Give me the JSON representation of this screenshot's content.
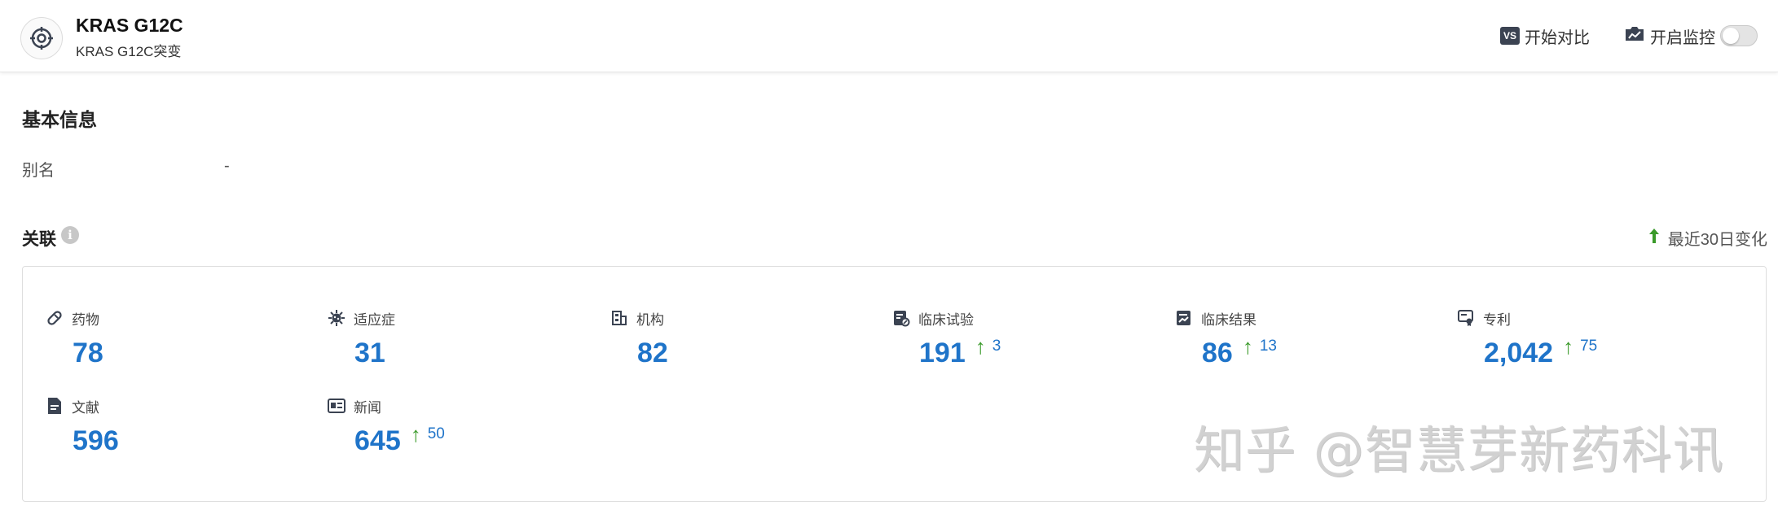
{
  "header": {
    "title": "KRAS G12C",
    "subtitle": "KRAS G12C突变",
    "compare": {
      "badge": "VS",
      "label": "开始对比"
    },
    "monitor": {
      "label": "开启监控",
      "enabled": false
    }
  },
  "basic_info": {
    "title": "基本信息",
    "alias_label": "别名",
    "alias_value": "-"
  },
  "related": {
    "title": "关联",
    "recent_label": "最近30日变化",
    "stats": [
      {
        "icon": "pill-icon",
        "label": "药物",
        "value": "78",
        "delta": null
      },
      {
        "icon": "virus-icon",
        "label": "适应症",
        "value": "31",
        "delta": null
      },
      {
        "icon": "building-icon",
        "label": "机构",
        "value": "82",
        "delta": null
      },
      {
        "icon": "clinical-trial-icon",
        "label": "临床试验",
        "value": "191",
        "delta": "3"
      },
      {
        "icon": "clinical-result-icon",
        "label": "临床结果",
        "value": "86",
        "delta": "13"
      },
      {
        "icon": "patent-icon",
        "label": "专利",
        "value": "2,042",
        "delta": "75"
      },
      {
        "icon": "document-icon",
        "label": "文献",
        "value": "596",
        "delta": null
      },
      {
        "icon": "news-icon",
        "label": "新闻",
        "value": "645",
        "delta": "50"
      }
    ]
  },
  "watermark": "知乎 @智慧芽新药科讯",
  "colors": {
    "value": "#1f74c9",
    "up_arrow": "#3a9a2a"
  }
}
